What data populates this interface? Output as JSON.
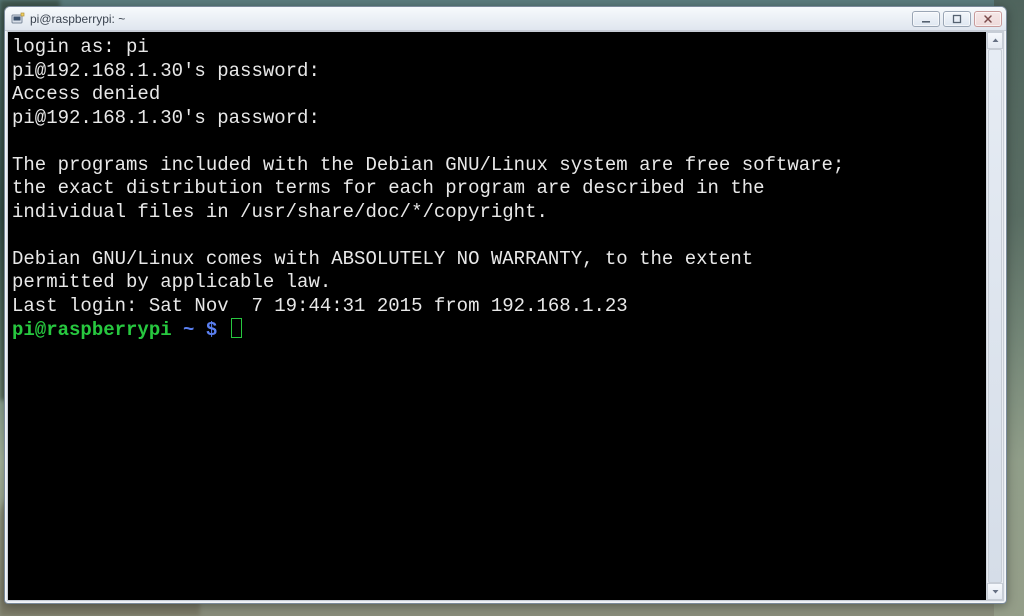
{
  "window": {
    "title": "pi@raspberrypi: ~",
    "icon_name": "putty-icon"
  },
  "terminal": {
    "lines": {
      "l1": "login as: pi",
      "l2": "pi@192.168.1.30's password:",
      "l3": "Access denied",
      "l4": "pi@192.168.1.30's password:",
      "l5": "",
      "l6": "The programs included with the Debian GNU/Linux system are free software;",
      "l7": "the exact distribution terms for each program are described in the",
      "l8": "individual files in /usr/share/doc/*/copyright.",
      "l9": "",
      "l10": "Debian GNU/Linux comes with ABSOLUTELY NO WARRANTY, to the extent",
      "l11": "permitted by applicable law.",
      "l12": "Last login: Sat Nov  7 19:44:31 2015 from 192.168.1.23"
    },
    "prompt": {
      "user_host": "pi@raspberrypi",
      "cwd": " ~ ",
      "symbol": "$ "
    }
  },
  "colors": {
    "terminal_bg": "#000000",
    "terminal_fg": "#e8e8e8",
    "prompt_green": "#27c83f",
    "prompt_blue": "#5a7ff0"
  }
}
